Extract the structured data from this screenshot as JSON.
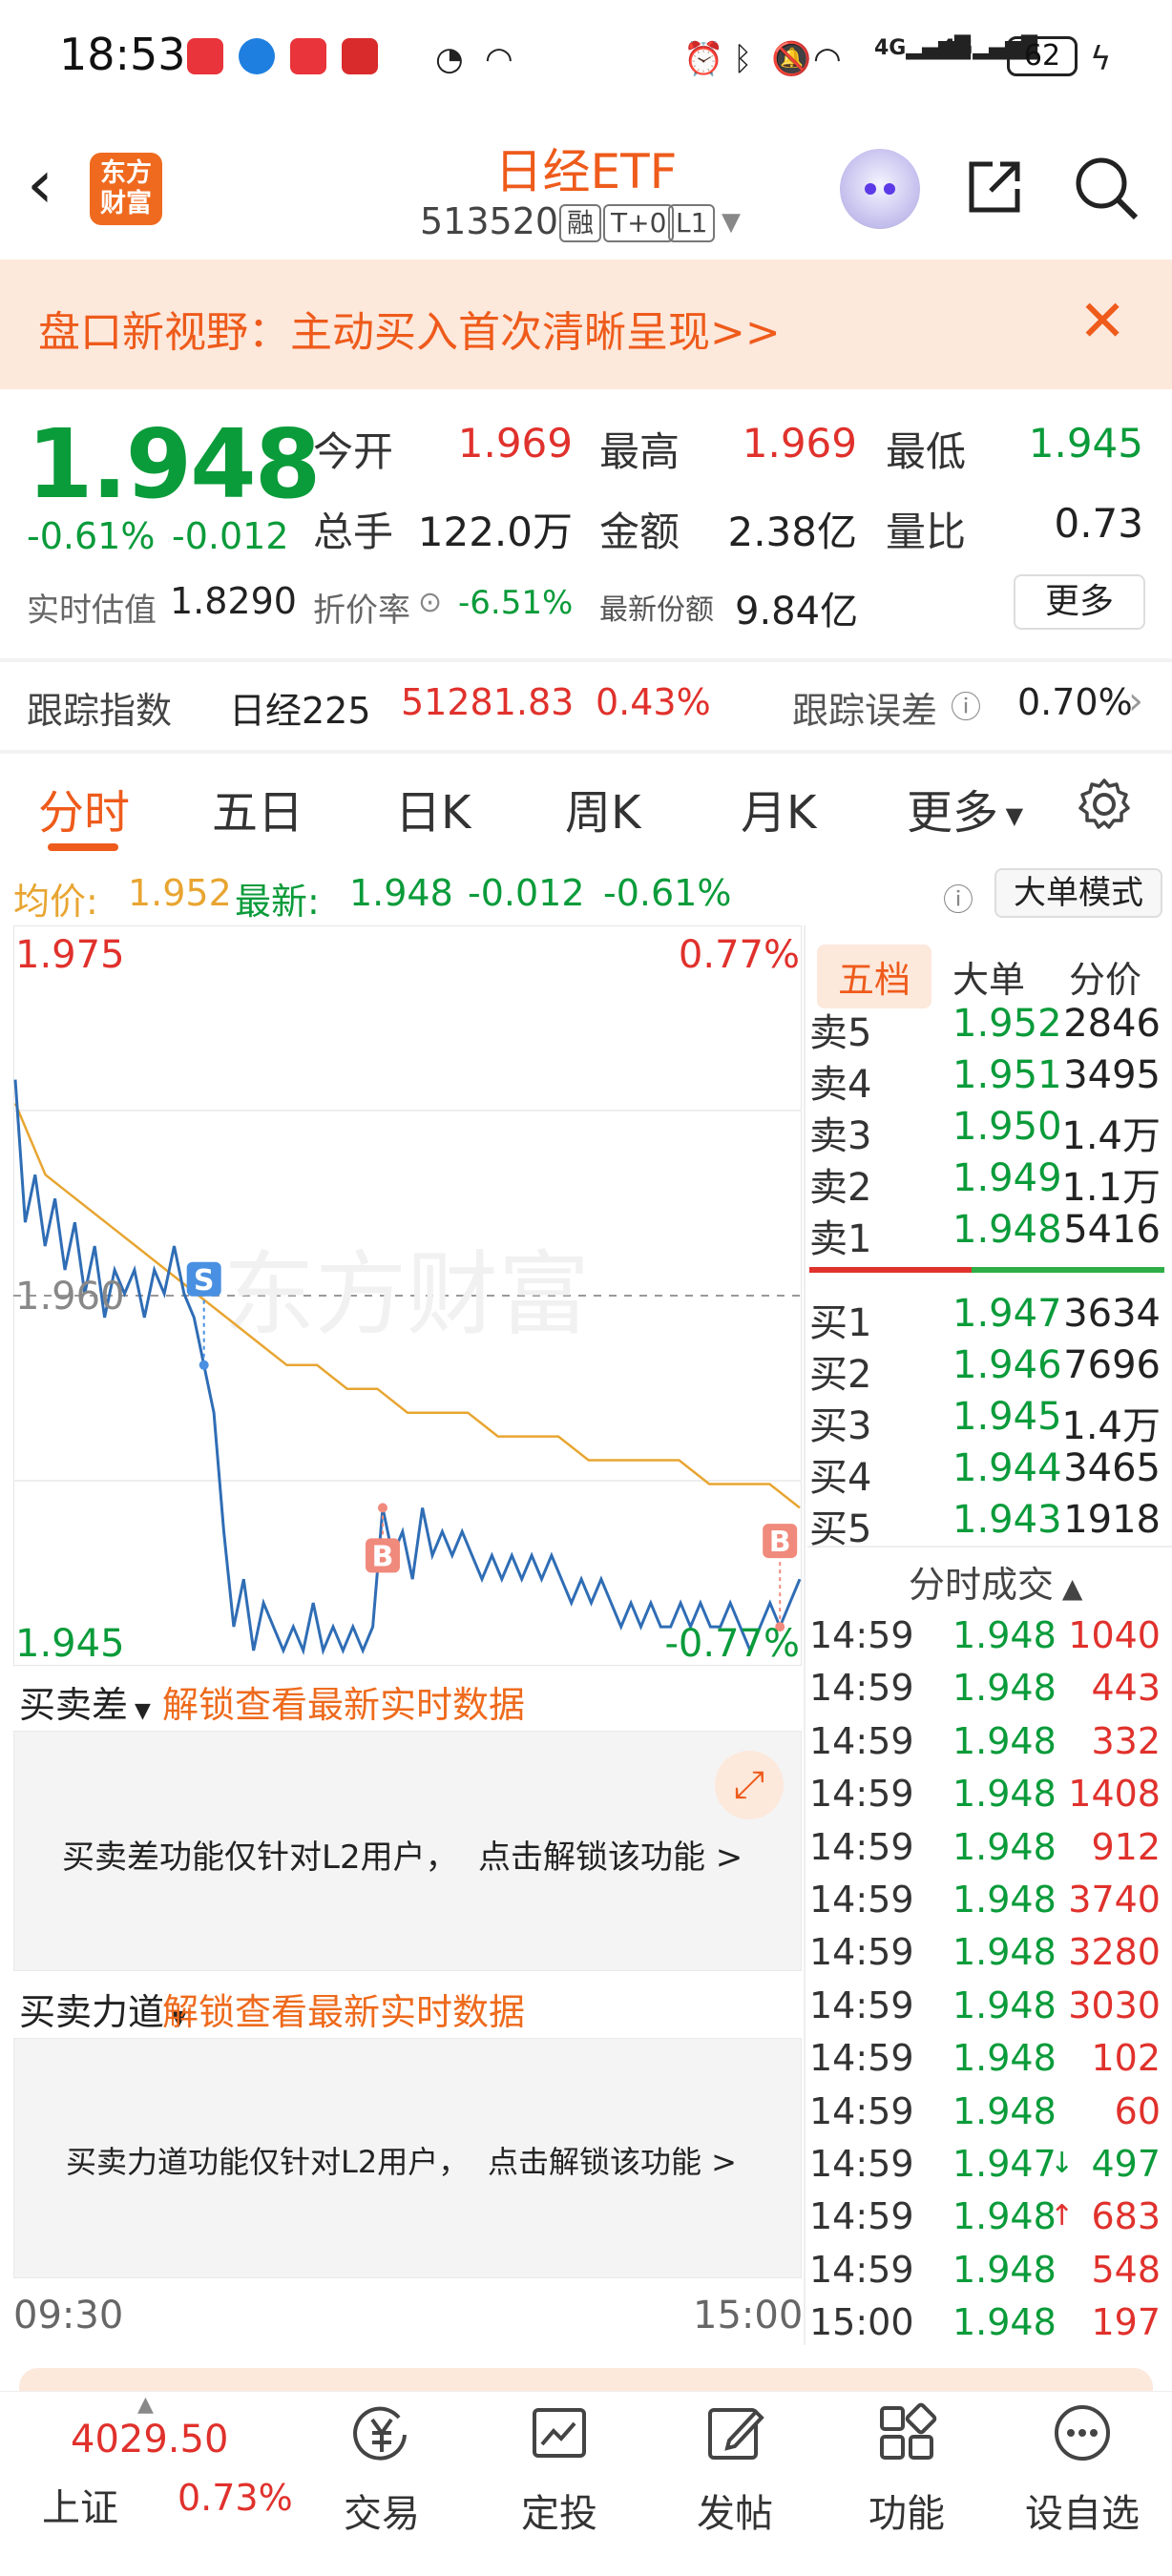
{
  "status_bar": {
    "time": "18:53",
    "network": "4G",
    "battery": "62"
  },
  "header": {
    "logo_text": "东方财富",
    "title": "日经ETF",
    "code": "513520",
    "tags": [
      "融",
      "T+0",
      "L1"
    ]
  },
  "banner": {
    "text": "盘口新视野：主动买入首次清晰呈现>>"
  },
  "quote": {
    "price": "1.948",
    "change_pct": "-0.61%",
    "change_amt": "-0.012",
    "open_label": "今开",
    "open_value": "1.969",
    "high_label": "最高",
    "high_value": "1.969",
    "low_label": "最低",
    "low_value": "1.945",
    "volume_label": "总手",
    "volume_value": "122.0万",
    "amount_label": "金额",
    "amount_value": "2.38亿",
    "ratio_label": "量比",
    "ratio_value": "0.73",
    "estimate_label": "实时估值",
    "estimate_value": "1.8290",
    "discount_label": "折价率",
    "discount_value": "-6.51%",
    "shares_label": "最新份额",
    "shares_value": "9.84亿",
    "more_label": "更多"
  },
  "tracking": {
    "label": "跟踪指数",
    "index_name": "日经225",
    "index_value": "51281.83",
    "index_change": "0.43%",
    "error_label": "跟踪误差",
    "error_value": "0.70%"
  },
  "tabs": [
    "分时",
    "五日",
    "日K",
    "周K",
    "月K",
    "更多"
  ],
  "avg_line": {
    "avg_label": "均价:",
    "avg_value": "1.952",
    "latest_label": "最新:",
    "latest_value": "1.948",
    "latest_change": "-0.012",
    "latest_pct": "-0.61%",
    "mode_button": "大单模式"
  },
  "chart_data": {
    "type": "line",
    "y_max_label": "1.975",
    "y_mid_label": "1.960",
    "y_min_label": "1.945",
    "pct_max_label": "0.77%",
    "pct_min_label": "-0.77%",
    "x_start": "09:30",
    "x_end": "15:00",
    "ylim": [
      1.945,
      1.975
    ],
    "watermark": "东方财富",
    "markers": [
      "S",
      "B",
      "B"
    ],
    "series": [
      {
        "values": [
          1.969,
          1.963,
          1.965,
          1.962,
          1.964,
          1.961,
          1.963,
          1.96,
          1.962,
          1.959,
          1.961,
          1.96,
          1.961,
          1.959,
          1.961,
          1.96,
          1.962,
          1.96,
          1.959,
          1.957,
          1.955,
          1.95,
          1.946,
          1.948,
          1.945,
          1.947,
          1.946,
          1.945,
          1.946,
          1.945,
          1.947,
          1.945,
          1.946,
          1.945,
          1.946,
          1.945,
          1.946,
          1.951,
          1.949,
          1.95,
          1.948,
          1.951,
          1.949,
          1.95,
          1.949,
          1.95,
          1.949,
          1.948,
          1.949,
          1.948,
          1.949,
          1.948,
          1.949,
          1.948,
          1.949,
          1.948,
          1.947,
          1.948,
          1.947,
          1.948,
          1.947,
          1.946,
          1.947,
          1.946,
          1.947,
          1.946,
          1.946,
          1.947,
          1.946,
          1.947,
          1.946,
          1.946,
          1.947,
          1.946,
          1.945,
          1.946,
          1.947,
          1.946,
          1.947,
          1.948
        ]
      },
      {
        "values": [
          1.968,
          1.965,
          1.964,
          1.963,
          1.962,
          1.961,
          1.96,
          1.959,
          1.958,
          1.957,
          1.957,
          1.956,
          1.956,
          1.955,
          1.955,
          1.955,
          1.954,
          1.954,
          1.954,
          1.953,
          1.953,
          1.953,
          1.953,
          1.952,
          1.952,
          1.952,
          1.951
        ]
      }
    ]
  },
  "sub_panels": {
    "panel1_select": "买卖差",
    "panel1_unlock": "解锁查看最新实时数据",
    "panel1_msg": "买卖差功能仅针对L2用户，",
    "panel1_link": "点击解锁该功能 >",
    "panel2_select": "买卖力道",
    "panel2_unlock": "解锁查看最新实时数据",
    "panel2_msg": "买卖力道功能仅针对L2用户，",
    "panel2_link": "点击解锁该功能 >"
  },
  "order_book": {
    "tabs": [
      "五档",
      "大单",
      "分价"
    ],
    "asks": [
      {
        "label": "卖5",
        "price": "1.952",
        "vol": "2846"
      },
      {
        "label": "卖4",
        "price": "1.951",
        "vol": "3495"
      },
      {
        "label": "卖3",
        "price": "1.950",
        "vol": "1.4万"
      },
      {
        "label": "卖2",
        "price": "1.949",
        "vol": "1.1万"
      },
      {
        "label": "卖1",
        "price": "1.948",
        "vol": "5416"
      }
    ],
    "bids": [
      {
        "label": "买1",
        "price": "1.947",
        "vol": "3634"
      },
      {
        "label": "买2",
        "price": "1.946",
        "vol": "7696"
      },
      {
        "label": "买3",
        "price": "1.945",
        "vol": "1.4万"
      },
      {
        "label": "买4",
        "price": "1.944",
        "vol": "3465"
      },
      {
        "label": "买5",
        "price": "1.943",
        "vol": "1918"
      }
    ],
    "ticks_title": "分时成交",
    "ticks": [
      {
        "time": "14:59",
        "price": "1.948",
        "vol": "1040",
        "dir": ""
      },
      {
        "time": "14:59",
        "price": "1.948",
        "vol": "443",
        "dir": ""
      },
      {
        "time": "14:59",
        "price": "1.948",
        "vol": "332",
        "dir": ""
      },
      {
        "time": "14:59",
        "price": "1.948",
        "vol": "1408",
        "dir": ""
      },
      {
        "time": "14:59",
        "price": "1.948",
        "vol": "912",
        "dir": ""
      },
      {
        "time": "14:59",
        "price": "1.948",
        "vol": "3740",
        "dir": ""
      },
      {
        "time": "14:59",
        "price": "1.948",
        "vol": "3280",
        "dir": ""
      },
      {
        "time": "14:59",
        "price": "1.948",
        "vol": "3030",
        "dir": ""
      },
      {
        "time": "14:59",
        "price": "1.948",
        "vol": "102",
        "dir": ""
      },
      {
        "time": "14:59",
        "price": "1.948",
        "vol": "60",
        "dir": ""
      },
      {
        "time": "14:59",
        "price": "1.947",
        "vol": "497",
        "dir": "↓"
      },
      {
        "time": "14:59",
        "price": "1.948",
        "vol": "683",
        "dir": "↑"
      },
      {
        "time": "14:59",
        "price": "1.948",
        "vol": "548",
        "dir": ""
      },
      {
        "time": "15:00",
        "price": "1.948",
        "vol": "197",
        "dir": ""
      }
    ]
  },
  "bottom_nav": {
    "index_value": "4029.50",
    "index_name": "上证",
    "index_change": "0.73%",
    "items": [
      "交易",
      "定投",
      "发帖",
      "功能",
      "设自选"
    ]
  },
  "colors": {
    "up": "#e0312c",
    "down": "#0a9b3a",
    "accent": "#ee5b1b",
    "price_line": "#2f6db5",
    "avg_line": "#e8a531"
  }
}
